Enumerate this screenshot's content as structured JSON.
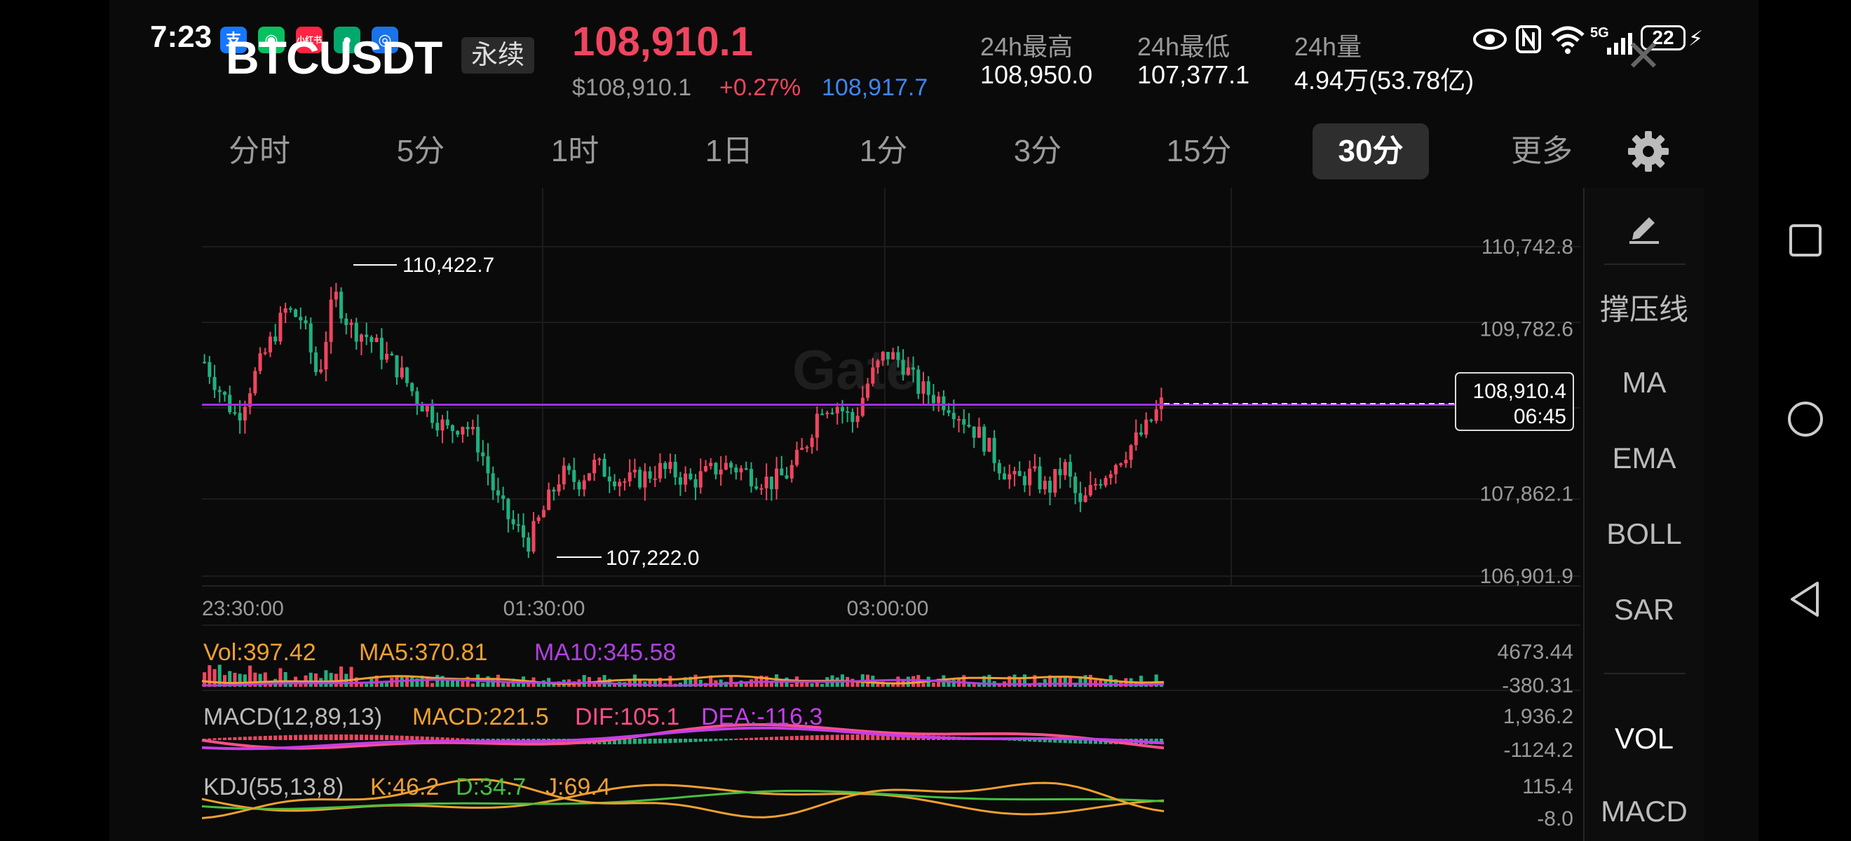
{
  "status_bar": {
    "time": "7:23",
    "app_icons": [
      {
        "name": "alipay-icon",
        "glyph": "支",
        "color": "#1677ff"
      },
      {
        "name": "wechat-icon",
        "glyph": "◉",
        "color": "#07c160"
      },
      {
        "name": "xiaohongshu-icon",
        "glyph": "小红书",
        "color": "#ff2442"
      },
      {
        "name": "chat-bubble-icon",
        "glyph": "●",
        "color": "#00a86b"
      },
      {
        "name": "browser-icon",
        "glyph": "◎",
        "color": "#1a73e8"
      }
    ],
    "signal": "5G",
    "battery": "22"
  },
  "header": {
    "symbol": "BTCUSDT",
    "contract_type": "永续",
    "last_price": "108,910.1",
    "usd_price": "$108,910.1",
    "change_pct": "+0.27%",
    "mark_price": "108,917.7",
    "stats": [
      {
        "label": "24h最高",
        "value": "108,950.0"
      },
      {
        "label": "24h最低",
        "value": "107,377.1"
      },
      {
        "label": "24h量",
        "value": "4.94万(53.78亿)"
      }
    ],
    "close_glyph": "✕"
  },
  "tabs": [
    {
      "label": "分时",
      "active": false
    },
    {
      "label": "5分",
      "active": false
    },
    {
      "label": "1时",
      "active": false
    },
    {
      "label": "1日",
      "active": false
    },
    {
      "label": "1分",
      "active": false
    },
    {
      "label": "3分",
      "active": false
    },
    {
      "label": "15分",
      "active": false
    },
    {
      "label": "30分",
      "active": true
    },
    {
      "label": "更多",
      "active": false
    }
  ],
  "sidebar": {
    "items": [
      {
        "label": "撑压线",
        "active": false
      },
      {
        "label": "MA",
        "active": false
      },
      {
        "label": "EMA",
        "active": false
      },
      {
        "label": "BOLL",
        "active": false
      },
      {
        "label": "SAR",
        "active": false
      },
      {
        "label": "VOL",
        "active": true
      },
      {
        "label": "MACD",
        "active": false
      }
    ]
  },
  "colors": {
    "up": "#f0455f",
    "down": "#20b080",
    "ma_line": "#a02ee0",
    "vol_label": "#f0a030",
    "ma5": "#f0a030",
    "ma10": "#b040e0",
    "macd_dif": "#ff4f8b",
    "macd_dea": "#c43ee8",
    "kdj_k": "#f0a030",
    "kdj_d": "#44c040",
    "kdj_j": "#f0a030"
  },
  "chart_data": {
    "type": "candlestick",
    "watermark": "Gate",
    "y_ticks": [
      "110,742.8",
      "109,782.6",
      "107,862.1",
      "106,901.9"
    ],
    "y_tick_values": [
      110742.8,
      109782.6,
      107862.1,
      106901.9
    ],
    "x_ticks": [
      "23:30:00",
      "01:30:00",
      "03:00:00"
    ],
    "high_marker": "110,422.7",
    "low_marker": "107,222.0",
    "current_price_label": "108,910.4",
    "countdown_label": "06:45",
    "ma_level": 108900,
    "close_path": [
      109400,
      109050,
      108750,
      109200,
      109600,
      110000,
      109900,
      109200,
      110200,
      109800,
      109700,
      109500,
      109300,
      109000,
      108800,
      108600,
      108700,
      108400,
      107800,
      107500,
      107300,
      107700,
      108100,
      108000,
      108200,
      108100,
      108000,
      108050,
      108150,
      108100,
      108000,
      108100,
      108200,
      108150,
      108050,
      108000,
      108100,
      108400,
      108900,
      108900,
      108700,
      109200,
      109500,
      109400,
      109100,
      109000,
      108900,
      108700,
      108500,
      108200,
      108000,
      108100,
      107900,
      108200,
      107700,
      108000,
      108200,
      108400,
      108600,
      108910
    ],
    "volume": {
      "label": "Vol:397.42",
      "ma5": "MA5:370.81",
      "ma10": "MA10:345.58",
      "max": "4673.44",
      "min": "-380.31"
    },
    "macd": {
      "label": "MACD(12,89,13)",
      "macd": "MACD:221.5",
      "dif": "DIF:105.1",
      "dea": "DEA:-116.3",
      "max": "1,936.2",
      "min": "-1124.2"
    },
    "kdj": {
      "label": "KDJ(55,13,8)",
      "k": "K:46.2",
      "d": "D:34.7",
      "j": "J:69.4",
      "max": "115.4",
      "min": "-8.0"
    }
  }
}
